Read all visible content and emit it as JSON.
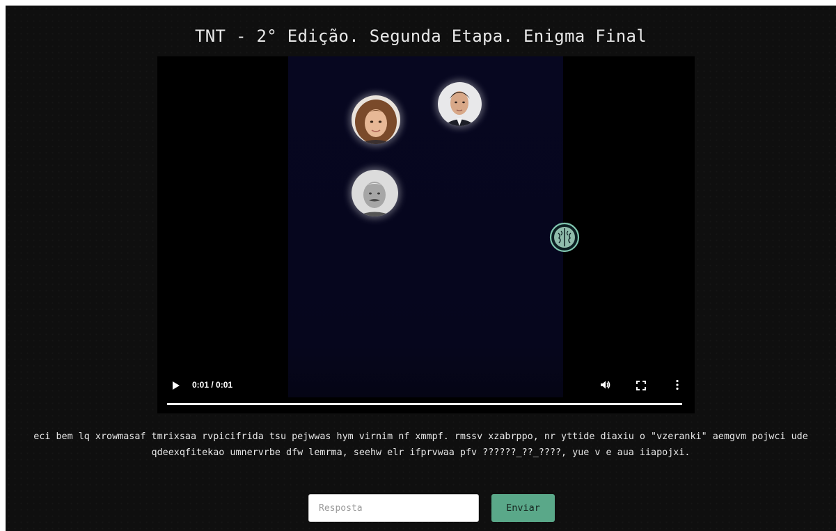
{
  "page": {
    "title": "TNT - 2° Edição. Segunda Etapa. Enigma Final"
  },
  "video": {
    "time_display": "0:01 / 0:01",
    "progress": 1.0,
    "content_icons": [
      "face-avatar-girl",
      "face-avatar-man-suit",
      "face-avatar-old-man",
      "brain-icon"
    ],
    "controls": {
      "play_icon": "play-icon",
      "volume_icon": "volume-icon",
      "fullscreen_icon": "fullscreen-icon",
      "more_icon": "more-options-icon"
    }
  },
  "riddle": {
    "text": "eci bem lq xrowmasaf tmrixsaa rvpicifrida tsu pejwwas hym virnim nf xmmpf. rmssv xzabrppo, nr yttide diaxiu o \"vzeranki\" aemgvm pojwci ude qdeexqfitekao umnervrbe dfw lemrma, seehw elr ifprvwaa pfv ??????_??_????, yue v e aua iiapojxi."
  },
  "form": {
    "answer_placeholder": "Resposta",
    "answer_value": "",
    "submit_label": "Enviar"
  },
  "colors": {
    "page_background": "#0f0f0f",
    "video_background": "#000000",
    "video_frame": "#070720",
    "accent": "#5aa889"
  }
}
